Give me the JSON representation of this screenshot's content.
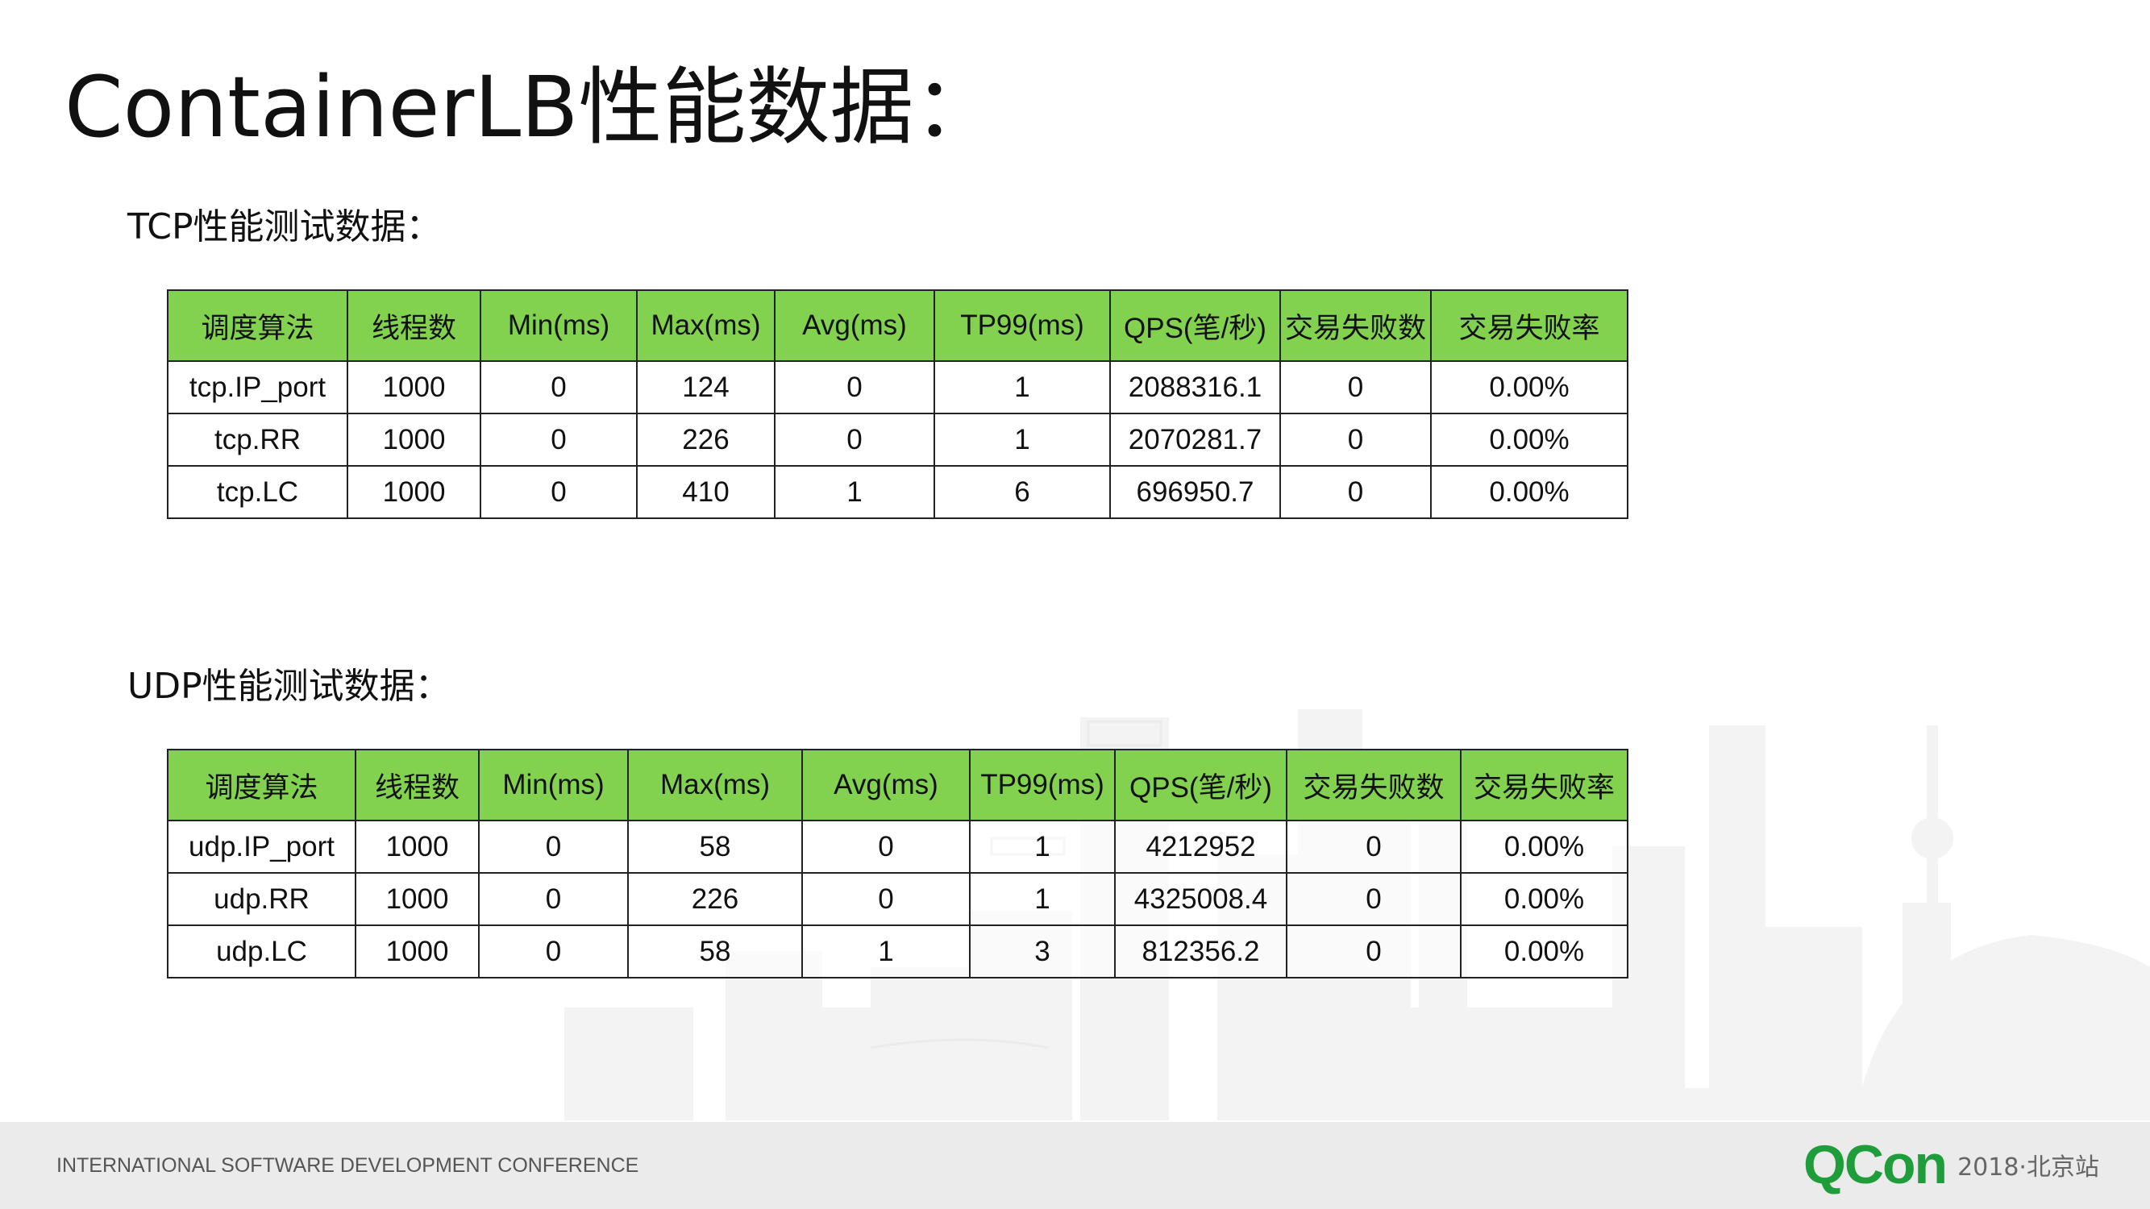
{
  "page_title": "ContainerLB性能数据：",
  "tcp": {
    "heading": "TCP性能测试数据：",
    "headers": [
      "调度算法",
      "线程数",
      "Min(ms)",
      "Max(ms)",
      "Avg(ms)",
      "TP99(ms)",
      "QPS(笔/秒)",
      "交易失败数",
      "交易失败率"
    ],
    "rows": [
      [
        "tcp.IP_port",
        "1000",
        "0",
        "124",
        "0",
        "1",
        "2088316.1",
        "0",
        "0.00%"
      ],
      [
        "tcp.RR",
        "1000",
        "0",
        "226",
        "0",
        "1",
        "2070281.7",
        "0",
        "0.00%"
      ],
      [
        "tcp.LC",
        "1000",
        "0",
        "410",
        "1",
        "6",
        "696950.7",
        "0",
        "0.00%"
      ]
    ]
  },
  "udp": {
    "heading": "UDP性能测试数据：",
    "headers": [
      "调度算法",
      "线程数",
      "Min(ms)",
      "Max(ms)",
      "Avg(ms)",
      "TP99(ms)",
      "QPS(笔/秒)",
      "交易失败数",
      "交易失败率"
    ],
    "rows": [
      [
        "udp.IP_port",
        "1000",
        "0",
        "58",
        "0",
        "1",
        "4212952",
        "0",
        "0.00%"
      ],
      [
        "udp.RR",
        "1000",
        "0",
        "226",
        "0",
        "1",
        "4325008.4",
        "0",
        "0.00%"
      ],
      [
        "udp.LC",
        "1000",
        "0",
        "58",
        "1",
        "3",
        "812356.2",
        "0",
        "0.00%"
      ]
    ]
  },
  "footer": {
    "conference": "INTERNATIONAL SOFTWARE DEVELOPMENT CONFERENCE",
    "logo": "QCon",
    "edition": "2018·北京站"
  },
  "colors": {
    "header_green": "#82d24f",
    "logo_green": "#1e9d3a",
    "footer_bg": "#ebebeb"
  }
}
